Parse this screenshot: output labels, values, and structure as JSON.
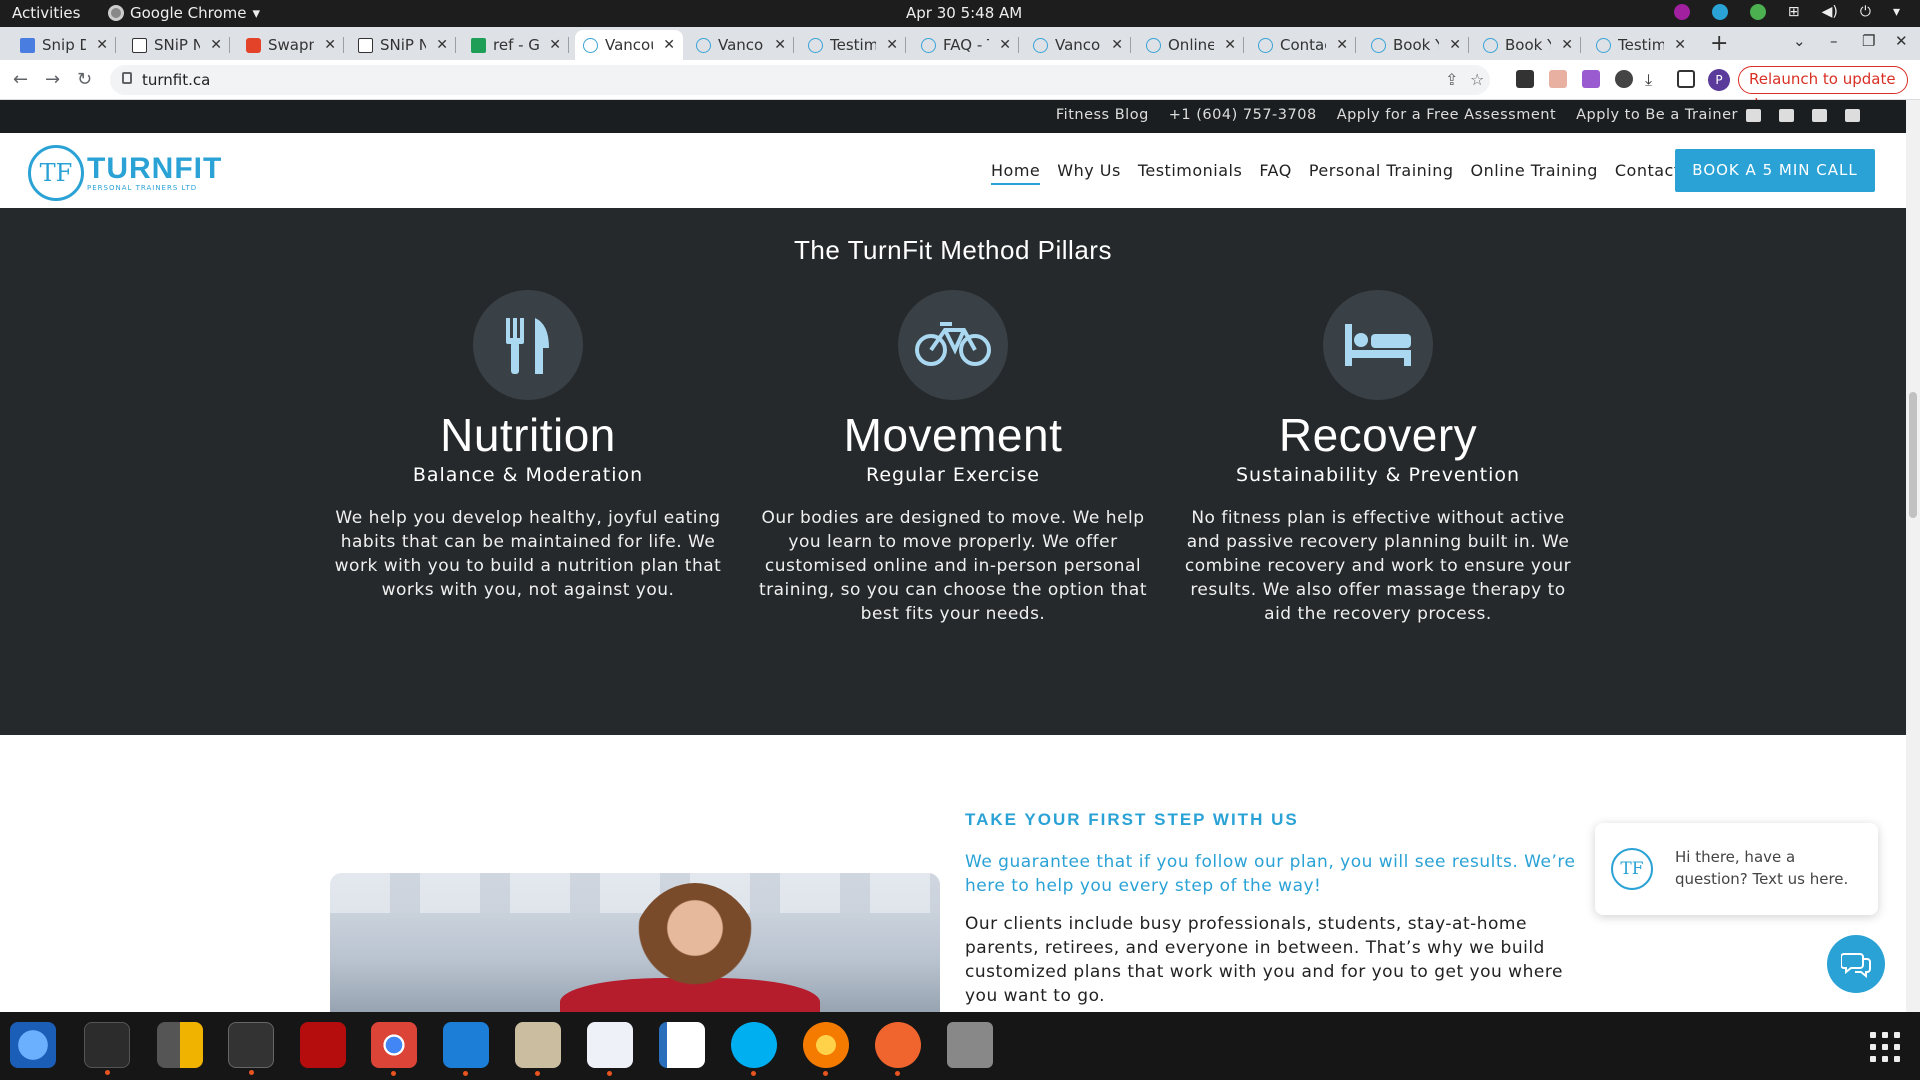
{
  "os": {
    "activities": "Activities",
    "app_name": "Google Chrome",
    "clock": "Apr 30  5:48 AM"
  },
  "browser": {
    "tabs": [
      {
        "label": "Snip De",
        "icon": "google-docs-icon"
      },
      {
        "label": "SNiP N",
        "icon": "snip-icon"
      },
      {
        "label": "Swapn",
        "icon": "gitlab-icon"
      },
      {
        "label": "SNiP N",
        "icon": "snip-icon"
      },
      {
        "label": "ref - Go",
        "icon": "google-sheets-icon"
      },
      {
        "label": "Vancou",
        "icon": "turnfit-icon"
      },
      {
        "label": "Vancou",
        "icon": "turnfit-icon"
      },
      {
        "label": "Testim",
        "icon": "turnfit-icon"
      },
      {
        "label": "FAQ - T",
        "icon": "turnfit-icon"
      },
      {
        "label": "Vancou",
        "icon": "turnfit-icon"
      },
      {
        "label": "Online",
        "icon": "turnfit-icon"
      },
      {
        "label": "Contac",
        "icon": "turnfit-icon"
      },
      {
        "label": "Book Y",
        "icon": "turnfit-icon"
      },
      {
        "label": "Book Y",
        "icon": "turnfit-icon"
      },
      {
        "label": "Testim",
        "icon": "turnfit-icon"
      }
    ],
    "active_tab_index": 5,
    "url": "turnfit.ca",
    "relaunch_label": "Relaunch to update",
    "profile_initial": "P"
  },
  "site": {
    "topbar_links": [
      "Fitness Blog",
      "+1 (604) 757-3708",
      "Apply for a Free Assessment",
      "Apply to Be a Trainer"
    ],
    "social_icons": [
      "twitter-icon",
      "facebook-icon",
      "youtube-icon",
      "instagram-icon"
    ],
    "logo": {
      "mark": "TF",
      "name": "TURNFIT",
      "tagline": "PERSONAL TRAINERS LTD"
    },
    "nav": [
      "Home",
      "Why Us",
      "Testimonials",
      "FAQ",
      "Personal Training",
      "Online Training",
      "Contact"
    ],
    "nav_active": "Home",
    "cta": "BOOK A 5 MIN CALL",
    "pillars_title": "The TurnFit Method Pillars",
    "pillars": [
      {
        "icon": "utensils-icon",
        "name": "Nutrition",
        "sub": "Balance & Moderation",
        "desc": "We help you develop healthy, joyful eating habits that can be maintained for life. We work with you to build a nutrition plan that works with you, not against you."
      },
      {
        "icon": "bicycle-icon",
        "name": "Movement",
        "sub": "Regular Exercise",
        "desc": "Our bodies are designed to move. We help you learn to move properly. We offer customised online and in-person personal training, so you can choose the option that best fits your needs."
      },
      {
        "icon": "bed-icon",
        "name": "Recovery",
        "sub": "Sustainability & Prevention",
        "desc": "No fitness plan is effective without active and passive recovery planning built in. We combine recovery and work to ensure your results. We also offer massage therapy to aid the recovery process."
      }
    ],
    "first_step": {
      "kicker": "TAKE YOUR FIRST STEP WITH US",
      "guarantee": "We guarantee that if you follow our plan, you will see results. We’re here to help you every step of the way!",
      "clients": "Our clients include busy professionals, students, stay-at-home parents, retirees, and everyone in between. That’s why we build customized plans that work with you and for you to get you where you want to go."
    },
    "chat": {
      "avatar": "TF",
      "text": "Hi there, have a question? Text us here."
    }
  },
  "colors": {
    "brand": "#2aa2d6",
    "dark_section": "#25292b",
    "topbar": "#1b1e20"
  },
  "dock": [
    "thunderbird-icon",
    "terminal-icon",
    "calculator-icon",
    "system-monitor-icon",
    "filezilla-icon",
    "chrome-icon",
    "vscode-icon",
    "files-icon",
    "text-editor-icon",
    "libreoffice-writer-icon",
    "skype-icon",
    "blender-icon",
    "inkscape-icon",
    "disk-icon"
  ]
}
